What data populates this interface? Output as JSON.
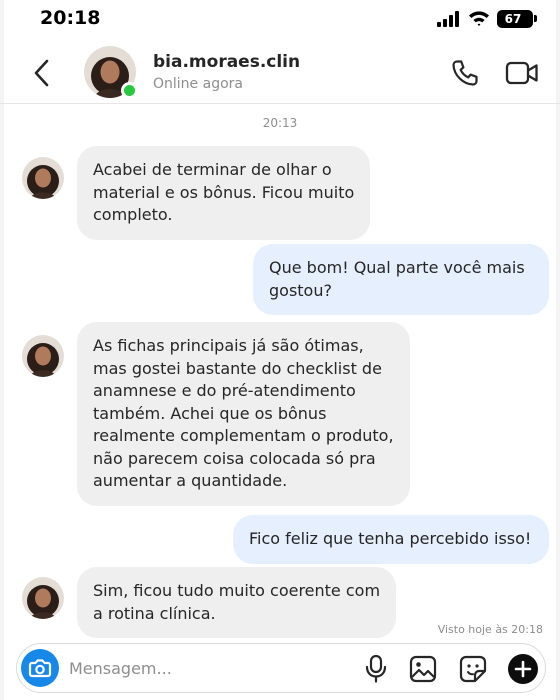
{
  "status_bar": {
    "time": "20:18",
    "battery": "67"
  },
  "header": {
    "contact_name": "bia.moraes.clin",
    "contact_status": "Online agora",
    "icons": [
      "back-chevron-icon",
      "phone-icon",
      "video-camera-icon"
    ]
  },
  "chat": {
    "timestamp": "20:13",
    "messages": [
      {
        "side": "in",
        "text": "Acabei de terminar de olhar o\nmaterial e os bônus. Ficou muito\ncompleto."
      },
      {
        "side": "out",
        "text": "Que bom! Qual parte você mais\ngostou?"
      },
      {
        "side": "in",
        "text": "As fichas principais já são ótimas,\nmas gostei bastante do checklist de\nanamnese e do pré-atendimento\ntambém. Achei que os bônus\nrealmente complementam o produto,\nnão parecem coisa colocada só pra\naumentar a quantidade."
      },
      {
        "side": "out",
        "text": "Fico feliz que tenha percebido isso!"
      },
      {
        "side": "in",
        "text": "Sim, ficou tudo muito coerente com\na rotina clínica."
      }
    ],
    "seen_text": "Visto hoje às 20:18"
  },
  "composer": {
    "placeholder": "Mensagem...",
    "icons": [
      "camera-icon",
      "microphone-icon",
      "image-icon",
      "sticker-icon",
      "plus-icon"
    ]
  },
  "colors": {
    "incoming_bubble": "#efefef",
    "outgoing_bubble": "#e6effd",
    "online": "#28c940",
    "camera_button": "#1787e8"
  }
}
